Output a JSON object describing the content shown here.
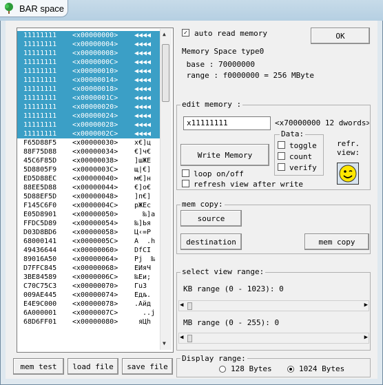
{
  "window": {
    "title": "BAR space"
  },
  "memory_list": {
    "rows": [
      {
        "value": "11111111",
        "addr": "<x00000000>",
        "chars": "◀◀◀◀",
        "selected": true
      },
      {
        "value": "11111111",
        "addr": "<x00000004>",
        "chars": "◀◀◀◀",
        "selected": true
      },
      {
        "value": "11111111",
        "addr": "<x00000008>",
        "chars": "◀◀◀◀",
        "selected": true
      },
      {
        "value": "11111111",
        "addr": "<x0000000C>",
        "chars": "◀◀◀◀",
        "selected": true
      },
      {
        "value": "11111111",
        "addr": "<x00000010>",
        "chars": "◀◀◀◀",
        "selected": true
      },
      {
        "value": "11111111",
        "addr": "<x00000014>",
        "chars": "◀◀◀◀",
        "selected": true
      },
      {
        "value": "11111111",
        "addr": "<x00000018>",
        "chars": "◀◀◀◀",
        "selected": true
      },
      {
        "value": "11111111",
        "addr": "<x0000001C>",
        "chars": "◀◀◀◀",
        "selected": true
      },
      {
        "value": "11111111",
        "addr": "<x00000020>",
        "chars": "◀◀◀◀",
        "selected": true
      },
      {
        "value": "11111111",
        "addr": "<x00000024>",
        "chars": "◀◀◀◀",
        "selected": true
      },
      {
        "value": "11111111",
        "addr": "<x00000028>",
        "chars": "◀◀◀◀",
        "selected": true
      },
      {
        "value": "11111111",
        "addr": "<x0000002C>",
        "chars": "◀◀◀◀",
        "selected": true
      },
      {
        "value": "F65D88F5",
        "addr": "<x00000030>",
        "chars": "х€]ц",
        "selected": false
      },
      {
        "value": "88F75D88",
        "addr": "<x00000034>",
        "chars": "€]ч€",
        "selected": false
      },
      {
        "value": "45C6F85D",
        "addr": "<x00000038>",
        "chars": "]шЖЕ",
        "selected": false
      },
      {
        "value": "5D8805F9",
        "addr": "<x0000003C>",
        "chars": "щ|€]",
        "selected": false
      },
      {
        "value": "ED5D88EC",
        "addr": "<x00000040>",
        "chars": "м€]н",
        "selected": false
      },
      {
        "value": "88EE5D88",
        "addr": "<x00000044>",
        "chars": "€]о€",
        "selected": false
      },
      {
        "value": "5D88EF5D",
        "addr": "<x00000048>",
        "chars": "]п€]",
        "selected": false
      },
      {
        "value": "F145C6F0",
        "addr": "<x0000004C>",
        "chars": "рЖЕс",
        "selected": false
      },
      {
        "value": "E05D8901",
        "addr": "<x00000050>",
        "chars": "  ‰]а",
        "selected": false
      },
      {
        "value": "FFDC5D89",
        "addr": "<x00000054>",
        "chars": "‰]Ья",
        "selected": false
      },
      {
        "value": "D03D8BD6",
        "addr": "<x00000058>",
        "chars": "Ц‹=Р",
        "selected": false
      },
      {
        "value": "68000141",
        "addr": "<x0000005C>",
        "chars": "A  .h",
        "selected": false
      },
      {
        "value": "49436644",
        "addr": "<x00000060>",
        "chars": "DfCI",
        "selected": false
      },
      {
        "value": "89016A50",
        "addr": "<x00000064>",
        "chars": "Pj  ‰",
        "selected": false
      },
      {
        "value": "D7FFC845",
        "addr": "<x00000068>",
        "chars": "EИяЧ",
        "selected": false
      },
      {
        "value": "3BE84589",
        "addr": "<x0000006C>",
        "chars": "‰Eи;",
        "selected": false
      },
      {
        "value": "C70C75C3",
        "addr": "<x00000070>",
        "chars": "Гu\fЗ",
        "selected": false
      },
      {
        "value": "009AE445",
        "addr": "<x00000074>",
        "chars": "Eдљ.",
        "selected": false
      },
      {
        "value": "E4E9C000",
        "addr": "<x00000078>",
        "chars": ".Айд",
        "selected": false
      },
      {
        "value": "6A000001",
        "addr": "<x0000007C>",
        "chars": "  ..j",
        "selected": false
      },
      {
        "value": "68D6FF01",
        "addr": "<x00000080>",
        "chars": " яЦh",
        "selected": false
      }
    ]
  },
  "buttons": {
    "mem_test": "mem test",
    "load_file": "load file",
    "save_file": "save file",
    "ok": "OK",
    "write_memory": "Write Memory",
    "source": "source",
    "destination": "destination",
    "mem_copy": "mem copy"
  },
  "info": {
    "auto_read_label": "auto read memory",
    "auto_read_checked": true,
    "type_line": "Memory Space type0",
    "base_line": " base : 70000000",
    "range_line": " range : f0000000 = 256 MByte"
  },
  "edit_memory": {
    "group_label": "edit memory :",
    "value": "x11111111",
    "address_text": "<x70000000 12 dwords>",
    "data_group_label": "Data:",
    "toggle": "toggle",
    "count": "count",
    "verify": "verify",
    "refr_view": "refr.\nview:",
    "loop": "loop on/off",
    "refresh_after_write": "refresh view after write"
  },
  "mem_copy": {
    "group_label": "mem copy:"
  },
  "view_range": {
    "group_label": "select view range:",
    "kb_label": "KB range (0 - 1023): 0",
    "mb_label": "MB range (0 - 255): 0"
  },
  "display_range": {
    "group_label": "Display range:",
    "opt_128": "128 Bytes",
    "opt_1024": "1024 Bytes",
    "selected": "1024 Bytes"
  }
}
